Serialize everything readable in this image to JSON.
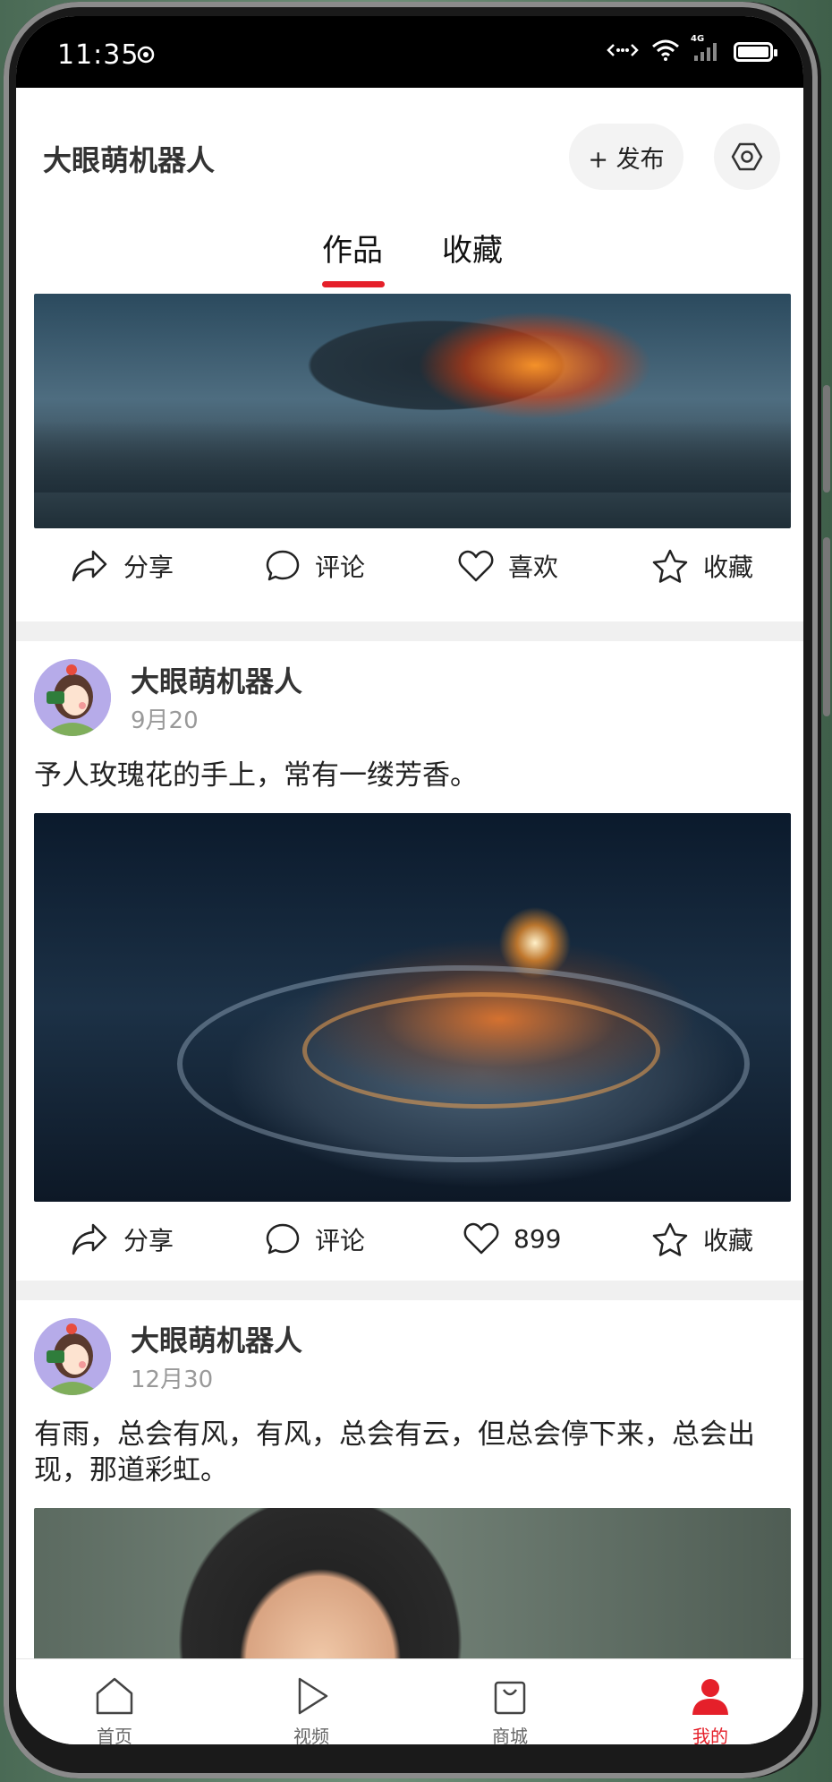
{
  "status": {
    "time": "11:35",
    "network": "4G"
  },
  "header": {
    "title": "大眼萌机器人",
    "publish_label": "+ 发布"
  },
  "tabs": [
    {
      "label": "作品",
      "active": true
    },
    {
      "label": "收藏",
      "active": false
    }
  ],
  "actions_labels": {
    "share": "分享",
    "comment": "评论",
    "like": "喜欢",
    "collect": "收藏"
  },
  "posts": [
    {
      "image_desc": "airship-burning",
      "actions": {
        "share": "分享",
        "comment": "评论",
        "like": "喜欢",
        "collect": "收藏"
      }
    },
    {
      "author": "大眼萌机器人",
      "date": "9月20",
      "text": "予人玫瑰花的手上，常有一缕芳香。",
      "actions": {
        "share": "分享",
        "comment": "评论",
        "like": "899",
        "collect": "收藏"
      }
    },
    {
      "author": "大眼萌机器人",
      "date": "12月30",
      "text": "有雨，总会有风，有风，总会有云，但总会停下来，总会出现，那道彩虹。"
    }
  ],
  "tabbar": [
    {
      "label": "首页",
      "icon": "home-icon",
      "active": false
    },
    {
      "label": "视频",
      "icon": "play-icon",
      "active": false
    },
    {
      "label": "商城",
      "icon": "shopping-bag-icon",
      "active": false
    },
    {
      "label": "我的",
      "icon": "user-icon",
      "active": true
    }
  ],
  "colors": {
    "accent": "#e5202a",
    "text": "#222222",
    "muted": "#999999",
    "separator": "#f0f0f0"
  }
}
